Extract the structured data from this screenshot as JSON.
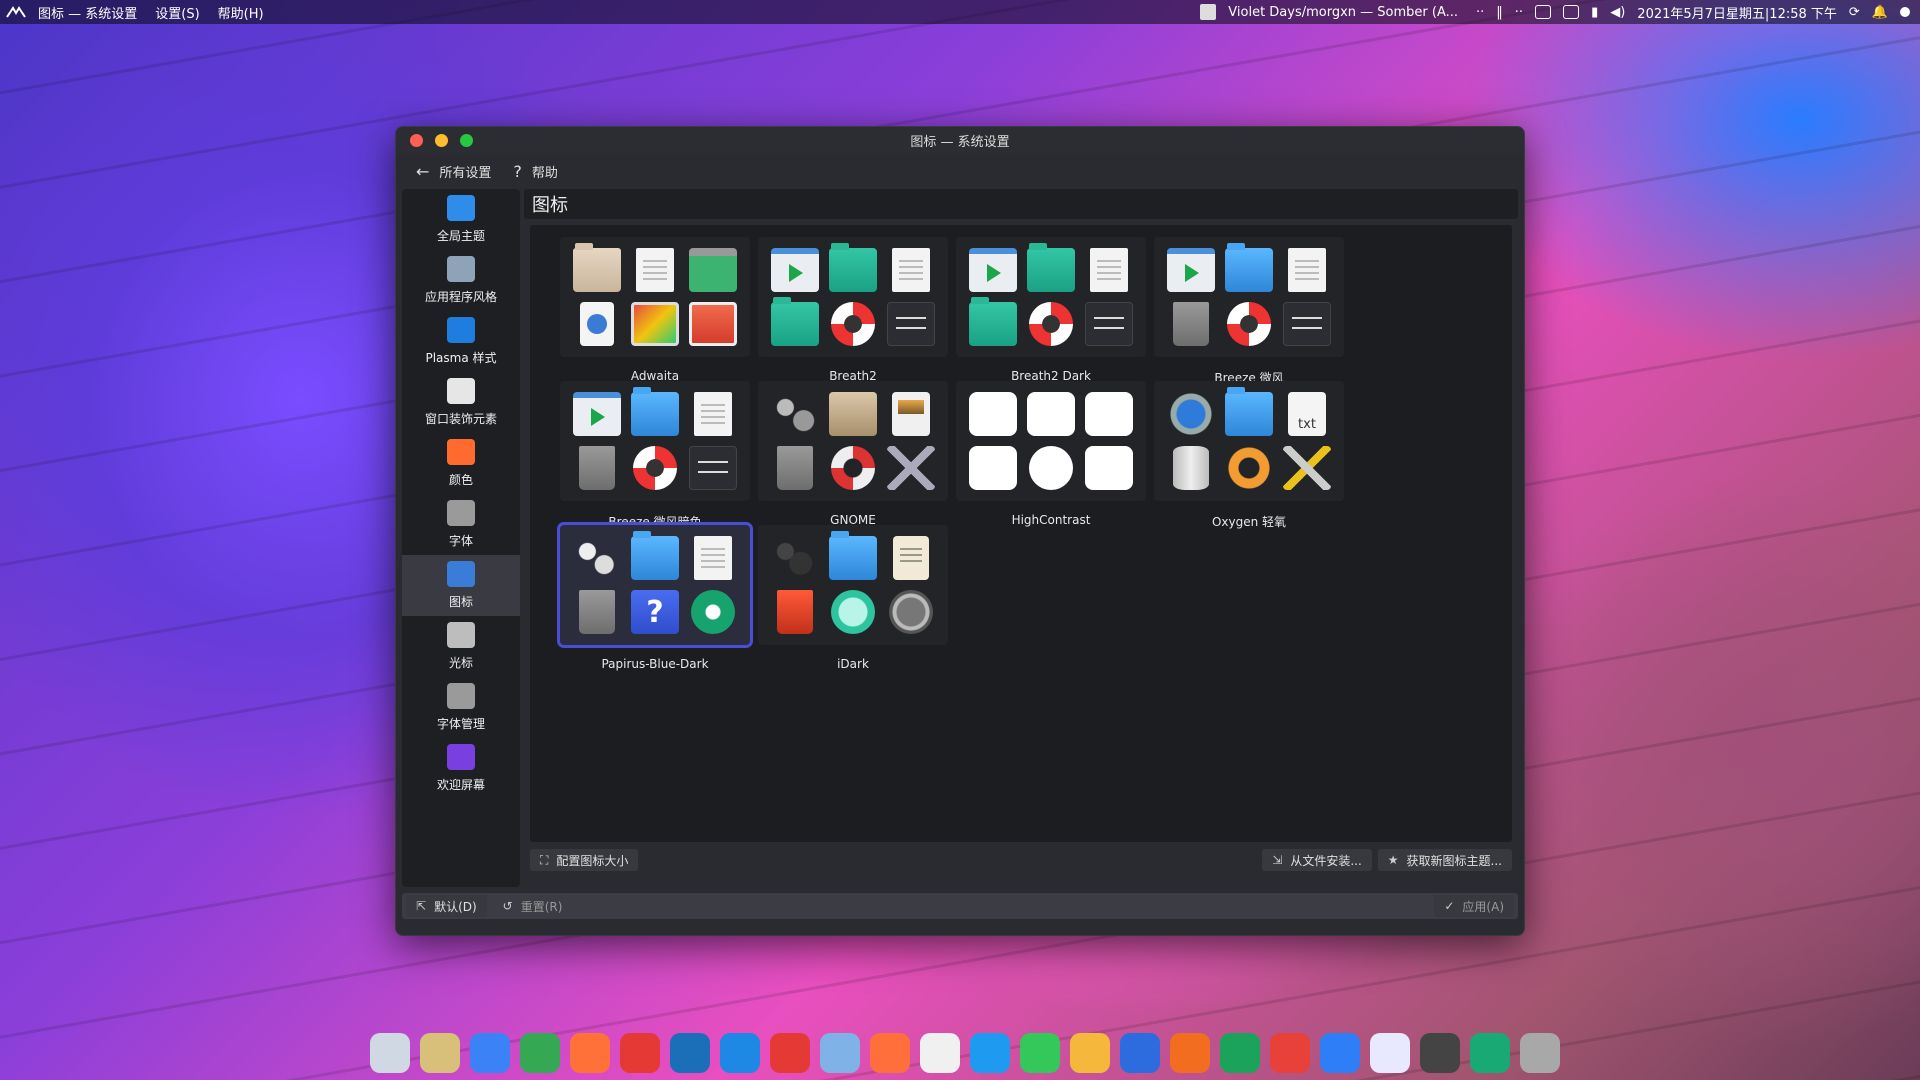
{
  "topbar": {
    "menu": [
      "图标 — 系统设置",
      "设置(S)",
      "帮助(H)"
    ],
    "now_playing": "Violet Days/morgxn — Somber (A...",
    "datetime": "2021年5月7日星期五|12:58 下午"
  },
  "window": {
    "title": "图标 — 系统设置",
    "toolbar": {
      "back_label": "所有设置",
      "help_label": "帮助"
    },
    "page_title": "图标"
  },
  "sidebar": {
    "items": [
      {
        "label": "全局主题",
        "icon": "global-theme-icon",
        "color": "#2f8ce8"
      },
      {
        "label": "应用程序风格",
        "icon": "app-style-icon",
        "color": "#8fa3b8"
      },
      {
        "label": "Plasma 样式",
        "icon": "plasma-style-icon",
        "color": "#1f7de0"
      },
      {
        "label": "窗口装饰元素",
        "icon": "window-decoration-icon",
        "color": "#e6e6e6"
      },
      {
        "label": "颜色",
        "icon": "colors-icon",
        "color": "#ff6b2e"
      },
      {
        "label": "字体",
        "icon": "fonts-icon",
        "color": "#9a9a9a"
      },
      {
        "label": "图标",
        "icon": "icons-icon",
        "color": "#3a7dd8"
      },
      {
        "label": "光标",
        "icon": "cursor-icon",
        "color": "#bdbdbd"
      },
      {
        "label": "字体管理",
        "icon": "font-management-icon",
        "color": "#9a9a9a"
      },
      {
        "label": "欢迎屏幕",
        "icon": "splash-screen-icon",
        "color": "#7a3fe0"
      }
    ],
    "active_index": 6
  },
  "themes": [
    {
      "name": "Adwaita",
      "icons": [
        "folder-tan",
        "doc",
        "recycle",
        "globe",
        "gradient",
        "video-red"
      ]
    },
    {
      "name": "Breath2",
      "icons": [
        "player",
        "folder-teal",
        "doc",
        "folder-teal",
        "lifebuoy",
        "slider"
      ]
    },
    {
      "name": "Breath2 Dark",
      "icons": [
        "player",
        "folder-teal",
        "doc",
        "folder-teal",
        "lifebuoy",
        "slider"
      ]
    },
    {
      "name": "Breeze 微风",
      "icons": [
        "player",
        "folder-blue",
        "doc",
        "trash",
        "lifebuoy",
        "slider"
      ]
    },
    {
      "name": "Breeze 微风暗色",
      "icons": [
        "player",
        "folder-blue",
        "doc",
        "trash",
        "lifebuoy",
        "slider"
      ]
    },
    {
      "name": "GNOME",
      "icons": [
        "gears",
        "folder-gray",
        "doc-photo",
        "trash",
        "lifebuoy2",
        "tools"
      ]
    },
    {
      "name": "HighContrast",
      "icons": [
        "hc",
        "hc",
        "hc",
        "hc",
        "hc-round",
        "hc"
      ]
    },
    {
      "name": "Oxygen 轻氧",
      "icons": [
        "player-blue",
        "folder-blue",
        "txt",
        "cylinder",
        "ring-orange",
        "tools-yellow"
      ]
    },
    {
      "name": "Papirus-Blue-Dark",
      "icons": [
        "gears-white",
        "folder-blue",
        "doc",
        "trash",
        "question",
        "gear-green"
      ],
      "selected": true
    },
    {
      "name": "iDark",
      "icons": [
        "gears-dark",
        "folder-blue",
        "doc-cream",
        "trash-red",
        "help-circle",
        "dial"
      ]
    }
  ],
  "txt_label": "txt",
  "question_mark": "?",
  "actions": {
    "configure_size": "配置图标大小",
    "install_from_file": "从文件安装...",
    "get_new_themes": "获取新图标主题..."
  },
  "footer": {
    "defaults": "默认(D)",
    "reset": "重置(R)",
    "apply": "应用(A)"
  },
  "dock": {
    "apps": [
      {
        "name": "manjaro-icon",
        "color": "#cfd8e3"
      },
      {
        "name": "files-icon",
        "color": "#d8c07a"
      },
      {
        "name": "software-icon",
        "color": "#3b82f6"
      },
      {
        "name": "chrome-icon",
        "color": "#34a853"
      },
      {
        "name": "firefox-icon",
        "color": "#ff7139"
      },
      {
        "name": "netease-music-icon",
        "color": "#e53935"
      },
      {
        "name": "steam-icon",
        "color": "#1b6fb8"
      },
      {
        "name": "vscode-icon",
        "color": "#1e88e5"
      },
      {
        "name": "xmind-icon",
        "color": "#e53935"
      },
      {
        "name": "cloud-icon",
        "color": "#7fb3e8"
      },
      {
        "name": "music-icon",
        "color": "#ff6f3c"
      },
      {
        "name": "qq-icon",
        "color": "#f0f0f0"
      },
      {
        "name": "app-star-icon",
        "color": "#1e9bf0"
      },
      {
        "name": "play-icon",
        "color": "#34c759"
      },
      {
        "name": "mango-icon",
        "color": "#f5b83d"
      },
      {
        "name": "wps-writer-icon",
        "color": "#2d6cdf"
      },
      {
        "name": "wps-presentation-icon",
        "color": "#f36d21"
      },
      {
        "name": "wps-spreadsheet-icon",
        "color": "#1ba35b"
      },
      {
        "name": "wps-pdf-icon",
        "color": "#e8413a"
      },
      {
        "name": "baidu-netdisk-icon",
        "color": "#2d7ef7"
      },
      {
        "name": "word-icon",
        "color": "#e8e8ff"
      },
      {
        "name": "obs-icon",
        "color": "#444"
      },
      {
        "name": "settings-icon",
        "color": "#19a974"
      },
      {
        "name": "trash-icon",
        "color": "#a8a8a8"
      }
    ]
  }
}
